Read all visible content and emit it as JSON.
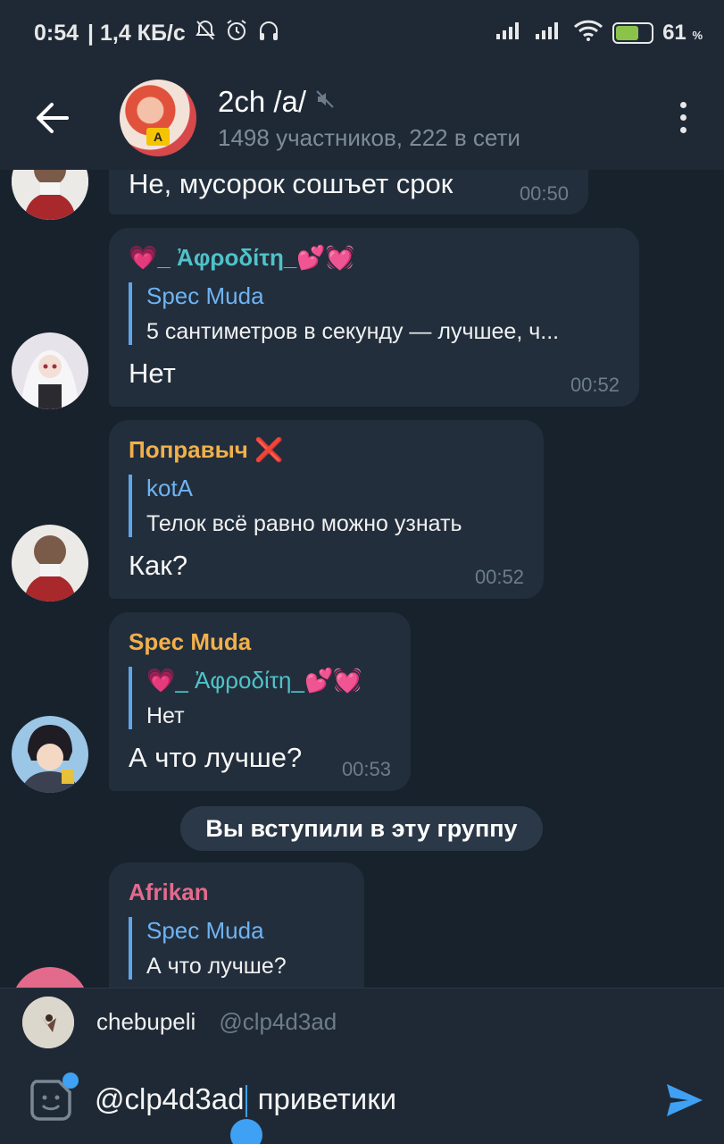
{
  "status_bar": {
    "time": "0:54",
    "speed": "| 1,4 КБ/с",
    "battery_percent": "61",
    "battery_unit": "%",
    "accent": "#8bc34a"
  },
  "header": {
    "back_icon": "arrow-left",
    "title": "2ch /a/",
    "muted_icon": "mute-icon",
    "subtitle": "1498 участников, 222 в сети",
    "menu_icon": "more-vertical"
  },
  "messages": [
    {
      "text": "Не, мусорок сошъет срок",
      "time": "00:50"
    },
    {
      "sender": "💗_ Ἀφροδίτη_💕💓",
      "sender_color": "#4fc3c8",
      "reply_name": "Spec Muda",
      "reply_text": "5 сантиметров в секунду — лучшее, ч...",
      "text": "Нет",
      "time": "00:52"
    },
    {
      "sender": "Поправыч ❌",
      "sender_color": "#f2b04a",
      "reply_name": "kotA",
      "reply_text": "Телок всё равно можно узнать",
      "text": "Как?",
      "time": "00:52"
    },
    {
      "sender": "Spec Muda",
      "sender_color": "#f2b04a",
      "reply_name": "💗_ Ἀφροδίτη_💕💓",
      "reply_text": "Нет",
      "text": "А что лучше?",
      "time": "00:53"
    },
    {
      "sender": "Afrikan",
      "sender_color": "#e46a8c",
      "reply_name": "Spec Muda",
      "reply_text": "А что лучше?"
    }
  ],
  "service_message": "Вы вступили в эту группу",
  "mention_suggestion": {
    "name": "chebupeli",
    "username": "@clp4d3ad"
  },
  "input": {
    "mention": "@clp4d3ad",
    "text": " приветики",
    "send_color": "#3ea1f3"
  }
}
